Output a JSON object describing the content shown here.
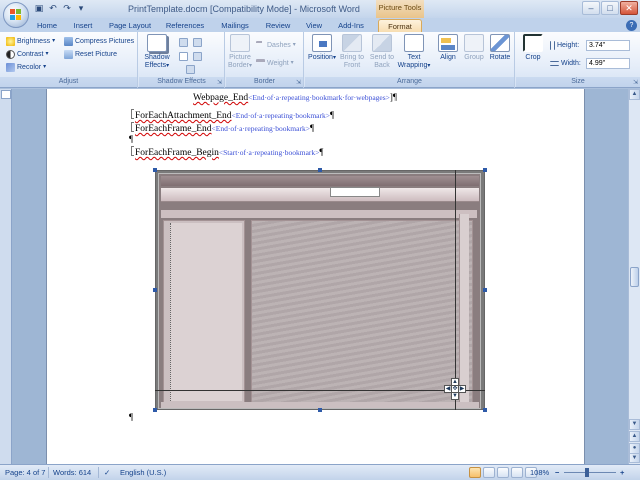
{
  "window": {
    "title": "PrintTemplate.docm [Compatibility Mode] - Microsoft Word",
    "context_tab_header": "Picture Tools",
    "buttons": {
      "minimize": "–",
      "maximize": "□",
      "close": "✕"
    }
  },
  "quick_access": [
    "save-icon",
    "undo-icon",
    "redo-icon",
    "customize-icon"
  ],
  "tabs": [
    {
      "label": "Home"
    },
    {
      "label": "Insert"
    },
    {
      "label": "Page Layout"
    },
    {
      "label": "References"
    },
    {
      "label": "Mailings"
    },
    {
      "label": "Review"
    },
    {
      "label": "View"
    },
    {
      "label": "Add-Ins"
    },
    {
      "label": "Format",
      "active": true
    }
  ],
  "ribbon": {
    "adjust": {
      "label": "Adjust",
      "brightness": "Brightness",
      "contrast": "Contrast",
      "recolor": "Recolor",
      "compress": "Compress Pictures",
      "reset": "Reset Picture"
    },
    "shadow": {
      "label": "Shadow Effects",
      "btn": "Shadow Effects"
    },
    "border": {
      "label": "Border",
      "picture_border": "Picture Border",
      "dashes": "Dashes",
      "weight": "Weight"
    },
    "arrange": {
      "label": "Arrange",
      "position": "Position",
      "bring_to_front": "Bring to Front",
      "send_to_back": "Send to Back",
      "text_wrapping": "Text Wrapping",
      "align": "Align",
      "group": "Group",
      "rotate": "Rotate"
    },
    "size": {
      "label": "Size",
      "crop": "Crop",
      "height_label": "Height:",
      "height": "3.74\"",
      "width_label": "Width:",
      "width": "4.99\""
    }
  },
  "document": {
    "line1_field": "Webpage_End",
    "line1_bm": "<End·of·a·repeating·bookmark·for·webpages>",
    "line2_field": "ForEachAttachment_End",
    "line2_bm": "<End·of·a·repeating·bookmark>",
    "line3_field": "ForEachFrame_End",
    "line3_bm": "<End·of·a·repeating·bookmark>",
    "line5_field": "ForEachFrame_Begin",
    "line5_bm": "<Start·of·a·repeating·bookmark>",
    "pilcrow": "¶"
  },
  "statusbar": {
    "page": "Page: 4 of 7",
    "words": "Words: 614",
    "language": "English (U.S.)",
    "zoom": "108%"
  },
  "colors": {
    "accent": "#15428b",
    "context_tab": "#e9c48b",
    "bookmark_text": "#3b4fd6"
  }
}
